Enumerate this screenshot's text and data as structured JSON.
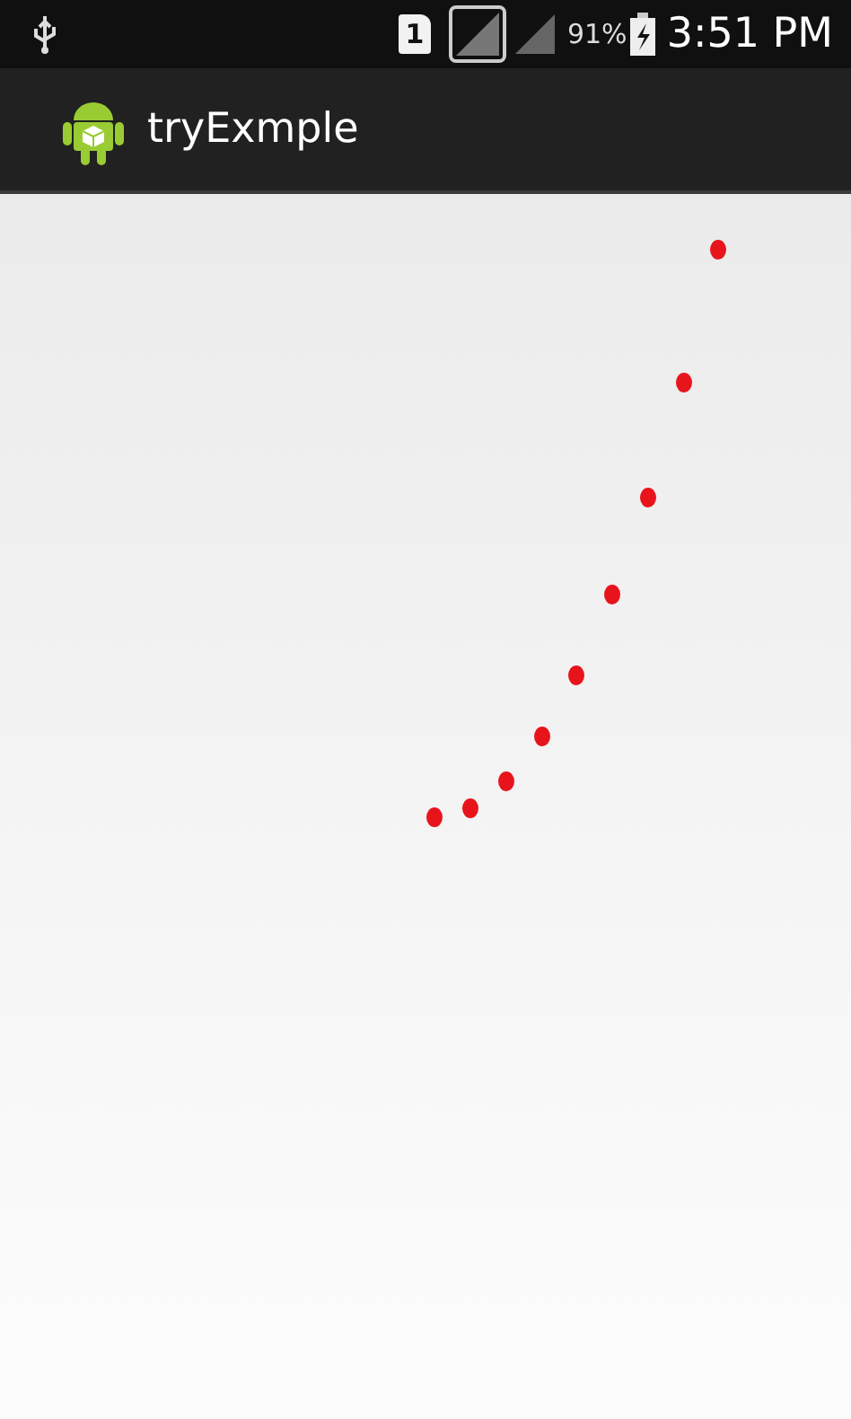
{
  "status_bar": {
    "sim_label": "1",
    "battery_percent": "91%",
    "time": "3:51 PM"
  },
  "action_bar": {
    "title": "tryExmple"
  }
}
